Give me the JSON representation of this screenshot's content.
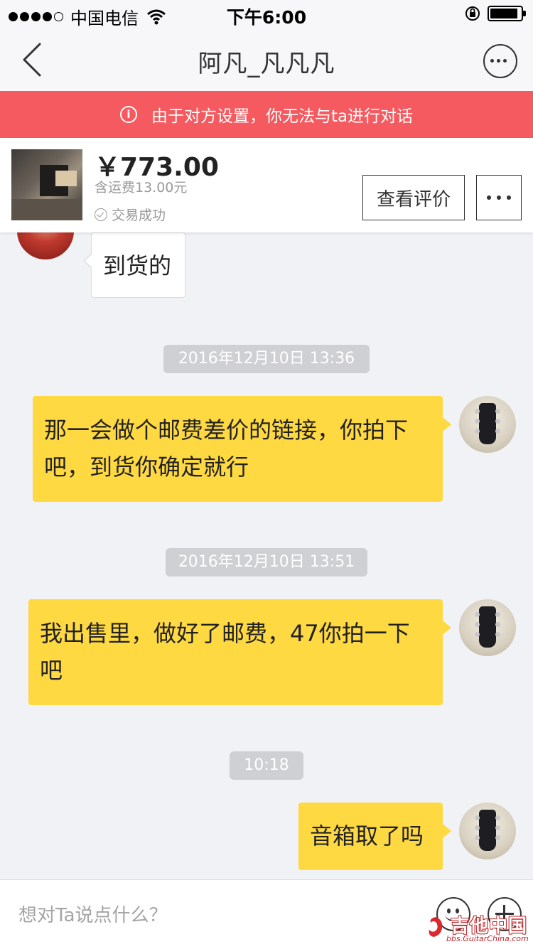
{
  "status_bar": {
    "carrier": "中国电信",
    "time": "下午6:00",
    "battery_level": 0.9
  },
  "nav": {
    "title": "阿凡_凡凡凡"
  },
  "alert": {
    "text": "由于对方设置，你无法与ta进行对话"
  },
  "product": {
    "price": "￥773.00",
    "shipping": "含运费13.00元",
    "status": "交易成功",
    "review_button": "查看评价"
  },
  "chat": {
    "messages": [
      {
        "type": "received",
        "text": "到货的"
      },
      {
        "type": "timestamp",
        "text": "2016年12月10日 13:36"
      },
      {
        "type": "sent",
        "text": "那一会做个邮费差价的链接，你拍下吧，到货你确定就行"
      },
      {
        "type": "timestamp",
        "text": "2016年12月10日 13:51"
      },
      {
        "type": "sent",
        "text": "我出售里，做好了邮费，47你拍一下吧"
      },
      {
        "type": "timestamp",
        "text": "10:18"
      },
      {
        "type": "sent",
        "text": "音箱取了吗"
      }
    ]
  },
  "input": {
    "placeholder": "想对Ta说点什么？"
  },
  "watermark": {
    "text": "吉他中国",
    "url": "bbs.GuitarChina.com"
  },
  "colors": {
    "alert_bg": "#f45a5f",
    "sent_bubble": "#ffd941",
    "received_bubble": "#ffffff",
    "timestamp_bg": "#cfd0d3",
    "chat_bg": "#f1f2f6"
  }
}
